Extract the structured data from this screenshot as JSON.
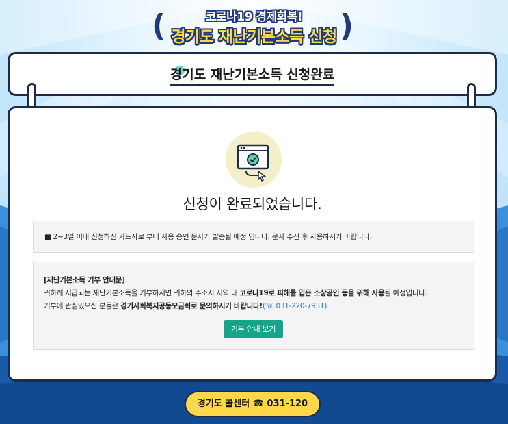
{
  "header": {
    "subtitle": "코로나19 경제회복!",
    "title": "경기도 재난기본소득 신청",
    "left_paren": "(",
    "right_paren": ")"
  },
  "title_card": {
    "title": "경기도 재난기본소득 신청완료"
  },
  "main": {
    "done_message": "신청이 완료되었습니다.",
    "notice1": "■ 2~3일 이내 신청하신 카드사로 부터 사용 승인 문자가 발송될 예정 입니다. 문자 수신 후 사용하시기 바랍니다.",
    "donation": {
      "heading": "[재난기본소득 기부 안내문]",
      "line1_prefix": "귀하께 지급되는 재난기본소득을 기부하시면 귀하의 주소지 지역 내 ",
      "line1_bold": "코로나19로 피해를 입은 소상공인 등을 위해 사용",
      "line1_suffix": "될 예정입니다.",
      "line2_prefix": "기부에 관심있으신 분들은 ",
      "line2_bold": "경기사회복지공동모금회로 문의하시기 바랍니다!",
      "line2_phone": "(☏ 031-220-7931)",
      "button_label": "기부 안내 보기"
    }
  },
  "footer": {
    "call_center": "경기도 콜센터 ☎ 031-120"
  },
  "colors": {
    "accent_yellow": "#ffd84a",
    "navy": "#1f2a44",
    "teal": "#17a589",
    "sky": "#cfe9fb",
    "blue": "#1a5aa6"
  }
}
